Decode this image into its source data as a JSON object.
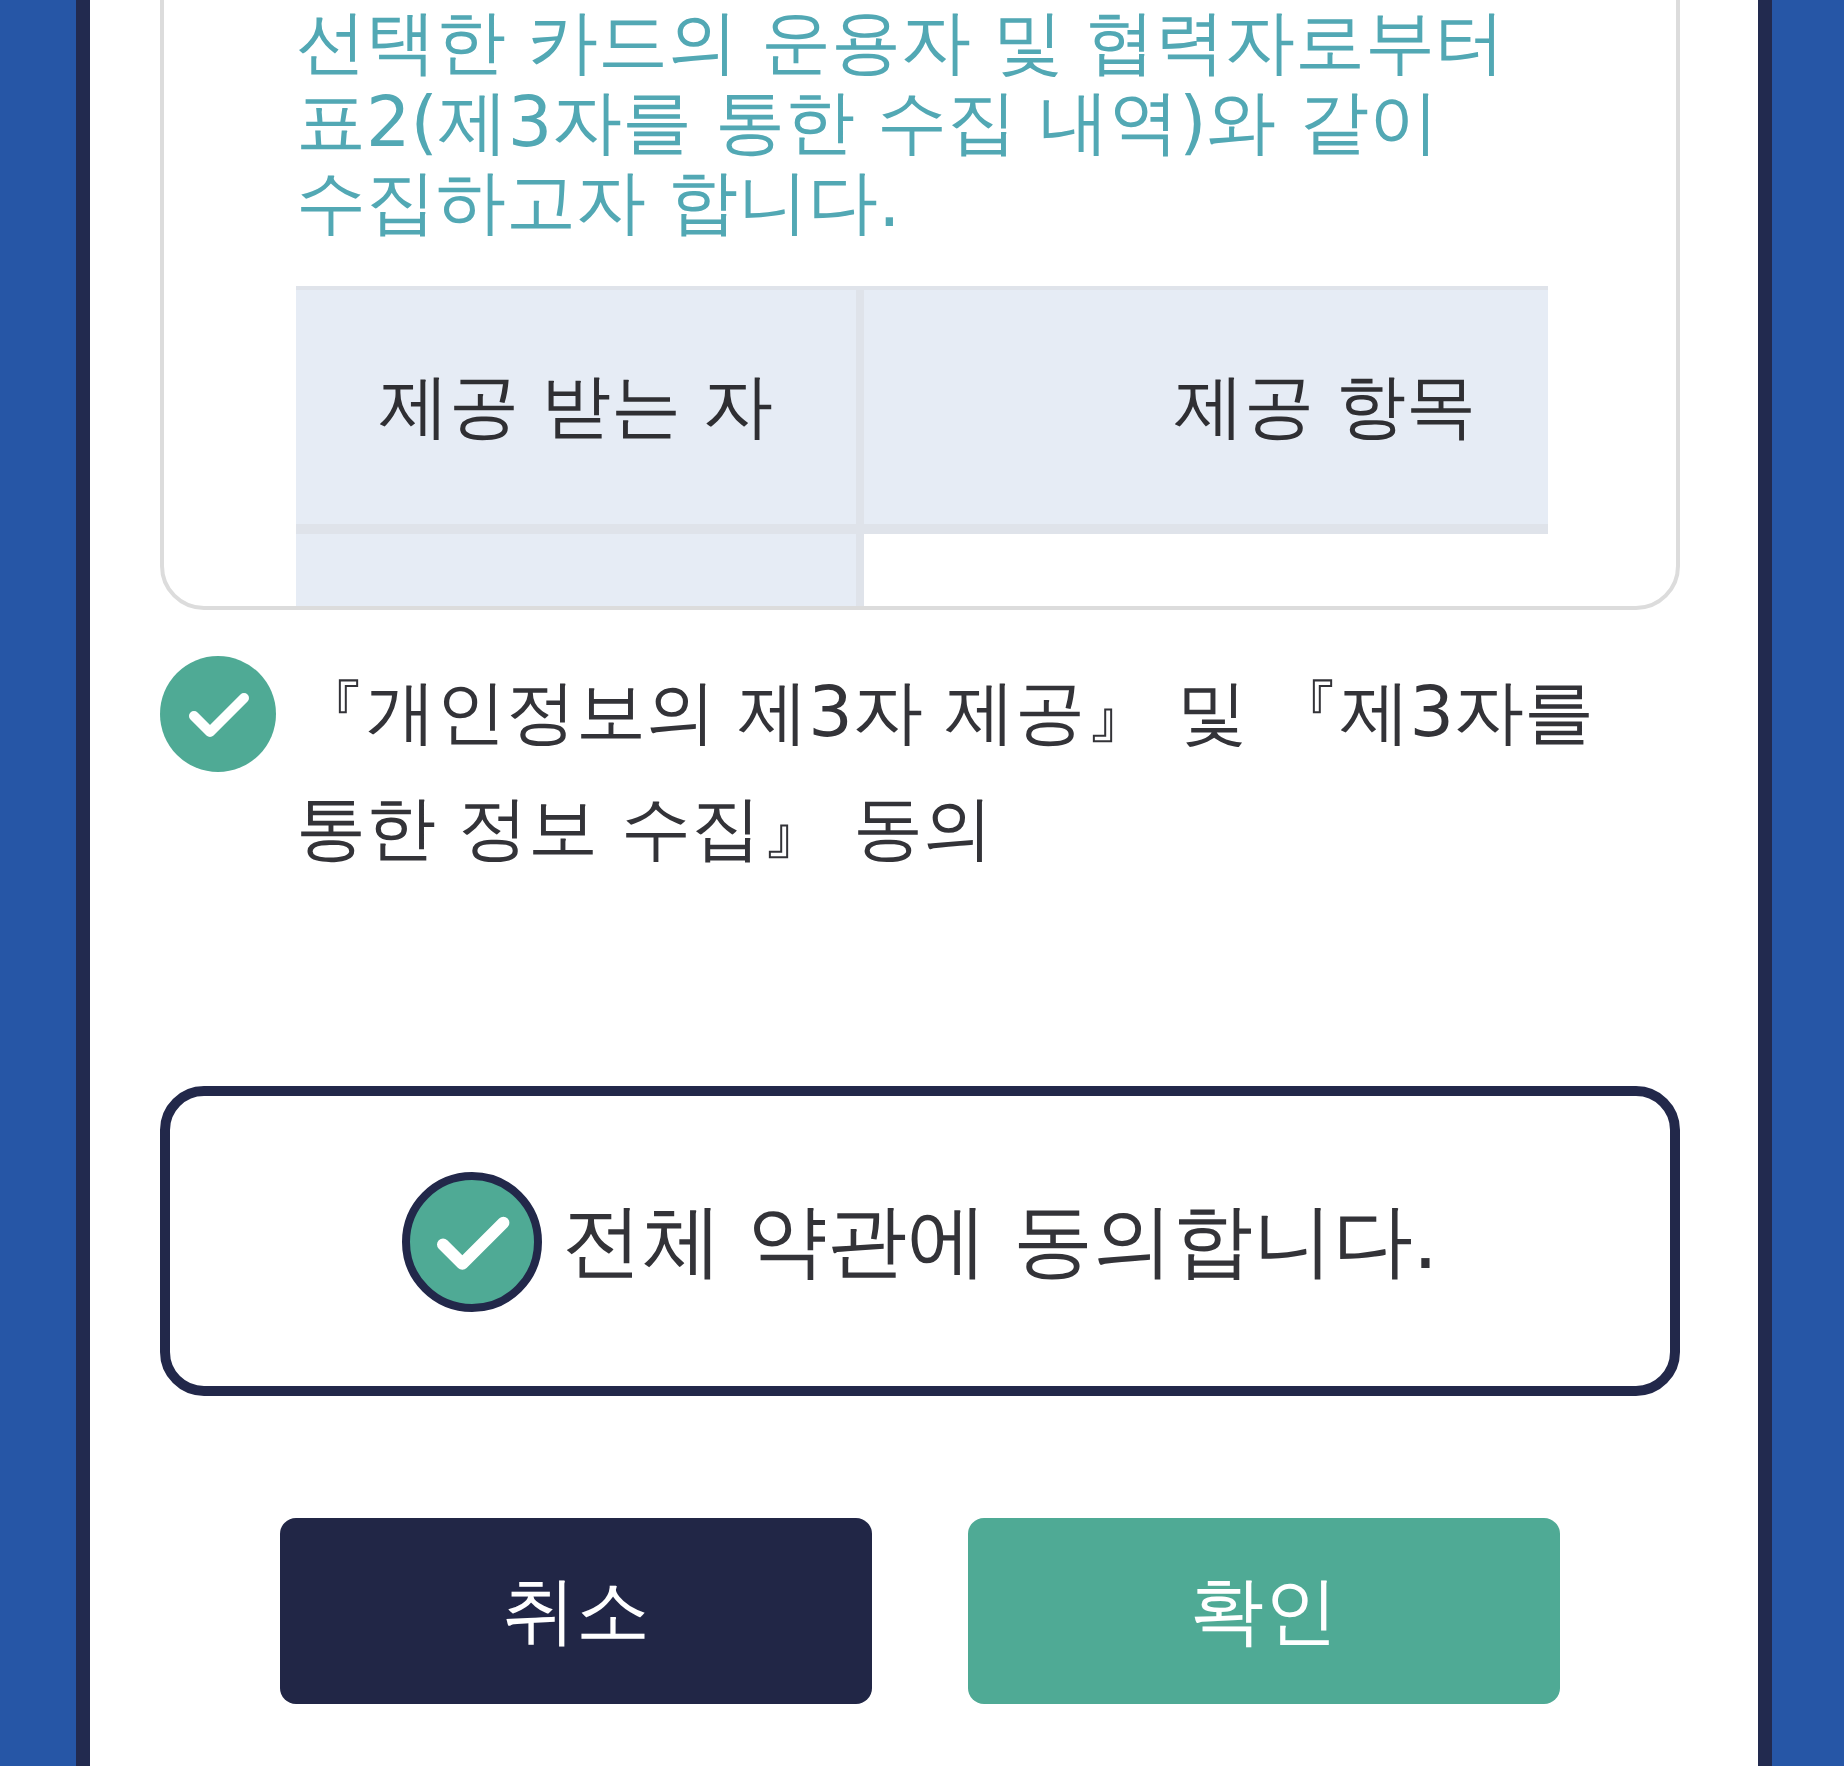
{
  "terms_card": {
    "paragraph": "선택한 카드의 운용자 및 협력자로부터 표2(제3자를 통한 수집 내역)와 같이 수집하고자 합니다.",
    "table": {
      "columns": [
        "제공 받는 자",
        "제공 항목"
      ]
    }
  },
  "third_party_consent": {
    "label": "『개인정보의 제3자 제공』 및 『제3자를 통한 정보 수집』 동의",
    "checked": true
  },
  "agree_all": {
    "label": "전체 약관에 동의합니다.",
    "checked": true
  },
  "buttons": [
    {
      "label": "취소",
      "kind": "secondary"
    },
    {
      "label": "확인",
      "kind": "primary"
    }
  ]
}
